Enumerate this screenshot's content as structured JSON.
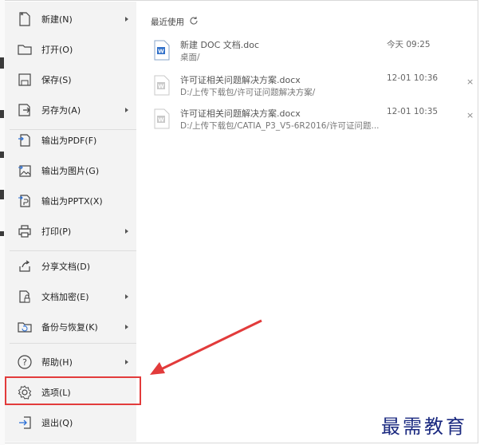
{
  "menu": {
    "items": [
      {
        "key": "new",
        "label": "新建(N)",
        "icon": "new-doc-icon",
        "submenu": true
      },
      {
        "key": "open",
        "label": "打开(O)",
        "icon": "folder-icon",
        "submenu": false
      },
      {
        "key": "save",
        "label": "保存(S)",
        "icon": "save-icon",
        "submenu": false
      },
      {
        "key": "saveas",
        "label": "另存为(A)",
        "icon": "save-as-icon",
        "submenu": true
      },
      {
        "key": "pdf",
        "label": "输出为PDF(F)",
        "icon": "export-pdf-icon",
        "submenu": false
      },
      {
        "key": "image",
        "label": "输出为图片(G)",
        "icon": "export-image-icon",
        "submenu": false
      },
      {
        "key": "pptx",
        "label": "输出为PPTX(X)",
        "icon": "export-pptx-icon",
        "submenu": false
      },
      {
        "key": "print",
        "label": "打印(P)",
        "icon": "printer-icon",
        "submenu": true
      },
      {
        "key": "share",
        "label": "分享文档(D)",
        "icon": "share-icon",
        "submenu": false
      },
      {
        "key": "encrypt",
        "label": "文档加密(E)",
        "icon": "lock-doc-icon",
        "submenu": true
      },
      {
        "key": "backup",
        "label": "备份与恢复(K)",
        "icon": "backup-icon",
        "submenu": true
      },
      {
        "key": "help",
        "label": "帮助(H)",
        "icon": "help-icon",
        "submenu": true
      },
      {
        "key": "options",
        "label": "选项(L)",
        "icon": "gear-icon",
        "submenu": false,
        "highlighted": true
      },
      {
        "key": "exit",
        "label": "退出(Q)",
        "icon": "exit-icon",
        "submenu": false
      }
    ]
  },
  "recent": {
    "title": "最近使用",
    "files": [
      {
        "name": "新建 DOC 文档.doc",
        "path": "桌面/",
        "time": "今天 09:25",
        "active": true,
        "closable": false
      },
      {
        "name": "许可证相关问题解决方案.docx",
        "path": "D:/上传下载包/许可证问题解决方案/",
        "time": "12-01 10:36",
        "active": false,
        "closable": true
      },
      {
        "name": "许可证相关问题解决方案.docx",
        "path": "D:/上传下载包/CATIA_P3_V5-6R2016/许可证问题...",
        "time": "12-01 10:35",
        "active": false,
        "closable": true
      }
    ],
    "close_symbol": "×"
  },
  "annotation": {
    "highlight_color": "#e23b3b"
  },
  "watermark": "最需教育"
}
